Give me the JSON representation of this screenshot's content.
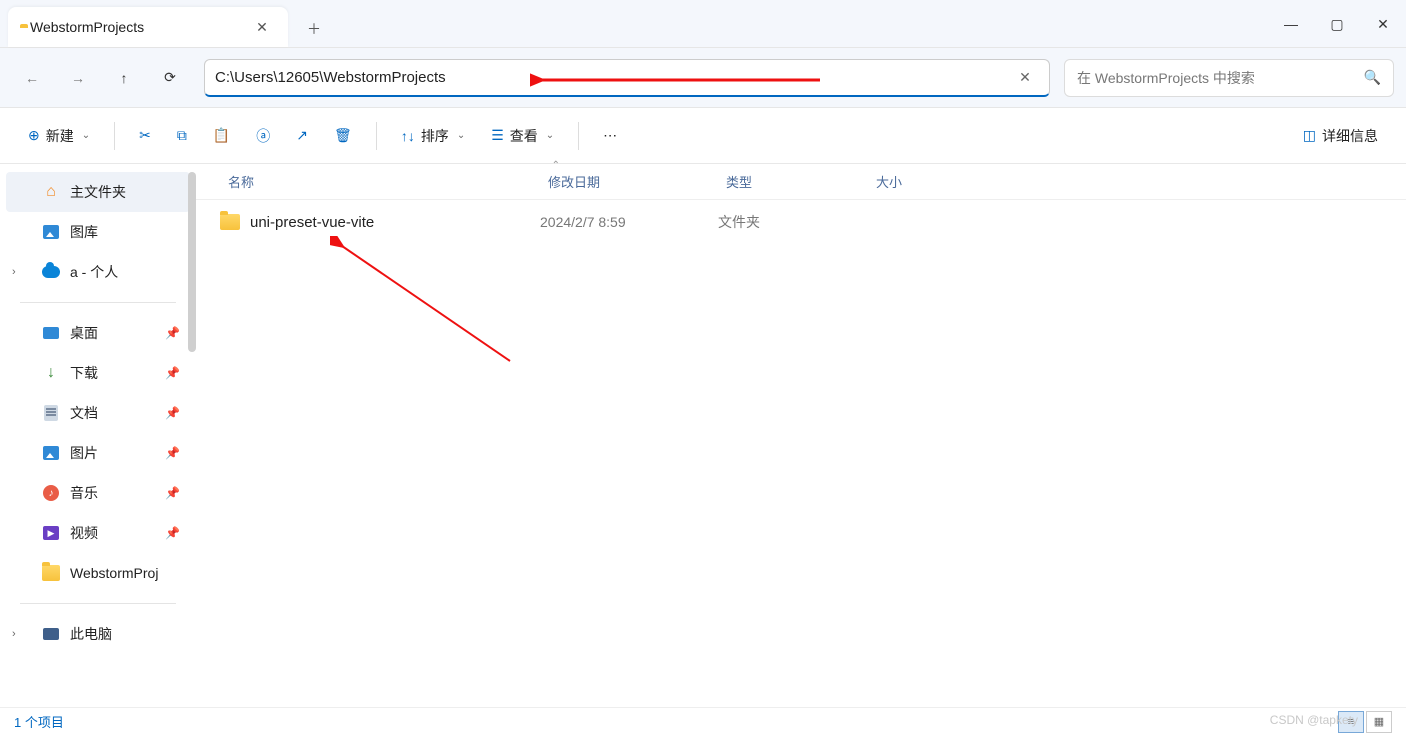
{
  "tab": {
    "title": "WebstormProjects"
  },
  "nav": {
    "path": "C:\\Users\\12605\\WebstormProjects",
    "search_placeholder": "在 WebstormProjects 中搜索"
  },
  "toolbar": {
    "new_label": "新建",
    "sort_label": "排序",
    "view_label": "查看",
    "details_label": "详细信息"
  },
  "columns": {
    "name": "名称",
    "date": "修改日期",
    "type": "类型",
    "size": "大小"
  },
  "sidebar": {
    "home": "主文件夹",
    "gallery": "图库",
    "onedrive": "a - 个人",
    "desktop": "桌面",
    "downloads": "下载",
    "documents": "文档",
    "pictures": "图片",
    "music": "音乐",
    "videos": "视频",
    "wsproj": "WebstormProj",
    "thispc": "此电脑"
  },
  "rows": [
    {
      "name": "uni-preset-vue-vite",
      "date": "2024/2/7 8:59",
      "type": "文件夹",
      "size": ""
    }
  ],
  "status": {
    "count": "1 个项目"
  },
  "watermark": "CSDN @tapkety"
}
